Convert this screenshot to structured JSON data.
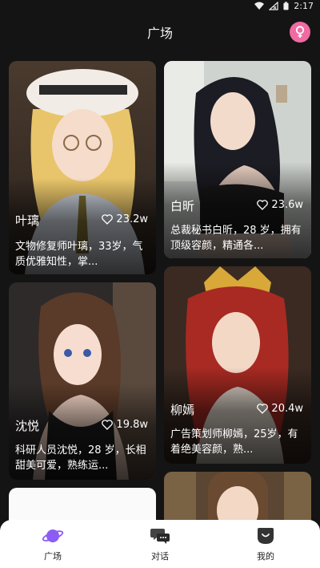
{
  "status_bar": {
    "time": "2:17"
  },
  "header": {
    "title": "广场",
    "gender_icon": "female-symbol-icon"
  },
  "colors": {
    "accent": "#8b5cf6",
    "gender_button": "#f06ba2",
    "background": "#141414"
  },
  "cards": [
    {
      "name": "叶璃",
      "likes": "23.2w",
      "desc": "文物修复师叶璃，33岁，气质优雅知性，掌..."
    },
    {
      "name": "白昕",
      "likes": "23.6w",
      "desc": "总裁秘书白昕，28 岁，拥有顶级容颜，精通各..."
    },
    {
      "name": "沈悦",
      "likes": "19.8w",
      "desc": "科研人员沈悦，28 岁，长相甜美可爱，熟练运..."
    },
    {
      "name": "柳嫣",
      "likes": "20.4w",
      "desc": "广告策划师柳嫣，25岁，有着绝美容颜，熟..."
    }
  ],
  "tabbar": {
    "items": [
      {
        "label": "广场",
        "icon": "planet-icon"
      },
      {
        "label": "对话",
        "icon": "chat-bubbles-icon"
      },
      {
        "label": "我的",
        "icon": "profile-icon"
      }
    ]
  }
}
